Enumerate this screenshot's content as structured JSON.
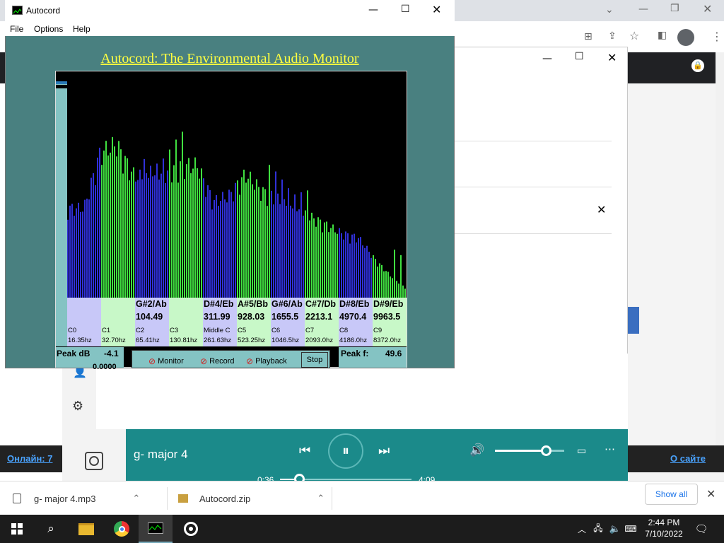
{
  "autocord": {
    "title": "Autocord",
    "menu": [
      "File",
      "Options",
      "Help"
    ],
    "heading": "Autocord: The Environmental Audio Monitor",
    "notes": [
      {
        "name": "",
        "freq": ""
      },
      {
        "name": "",
        "freq": ""
      },
      {
        "name": "G#2/Ab",
        "freq": "104.49"
      },
      {
        "name": "",
        "freq": ""
      },
      {
        "name": "D#4/Eb",
        "freq": "311.99"
      },
      {
        "name": "A#5/Bb",
        "freq": "928.03"
      },
      {
        "name": "G#6/Ab",
        "freq": "1655.5"
      },
      {
        "name": "C#7/Db",
        "freq": "2213.1"
      },
      {
        "name": "D#8/Eb",
        "freq": "4970.4"
      },
      {
        "name": "D#9/Eb",
        "freq": "9963.5"
      }
    ],
    "octaves": [
      {
        "name": "C0",
        "freq": "16.35hz"
      },
      {
        "name": "C1",
        "freq": "32.70hz"
      },
      {
        "name": "C2",
        "freq": "65.41hz"
      },
      {
        "name": "C3",
        "freq": "130.81hz"
      },
      {
        "name": "Middle C",
        "freq": "261.63hz"
      },
      {
        "name": "C5",
        "freq": "523.25hz"
      },
      {
        "name": "C6",
        "freq": "1046.5hz"
      },
      {
        "name": "C7",
        "freq": "2093.0hz"
      },
      {
        "name": "C8",
        "freq": "4186.0hz"
      },
      {
        "name": "C9",
        "freq": "8372.0hz"
      }
    ],
    "peak_db_label": "Peak dB",
    "peak_db_value": "-4.1",
    "peak_db_second": "0.0000",
    "monitor_label": "Monitor",
    "record_label": "Record",
    "playback_label": "Playback",
    "stop_label": "Stop",
    "peak_f_label": "Peak f:",
    "peak_f_value": "49.6",
    "colors": {
      "bg": "#498080",
      "low_band": "#3030d8",
      "high_band": "#40e040",
      "heading": "#ffff40"
    }
  },
  "player": {
    "track": "g- major 4",
    "elapsed": "0:36",
    "duration": "4:09",
    "progress": 0.145,
    "volume": 0.73
  },
  "browser": {
    "status_left": "Онлайн: 7",
    "status_right": "О сайте"
  },
  "downloads": {
    "items": [
      "g- major 4.mp3",
      "Autocord.zip"
    ],
    "show_all": "Show all"
  },
  "taskbar": {
    "time": "2:44 PM",
    "date": "7/10/2022"
  }
}
